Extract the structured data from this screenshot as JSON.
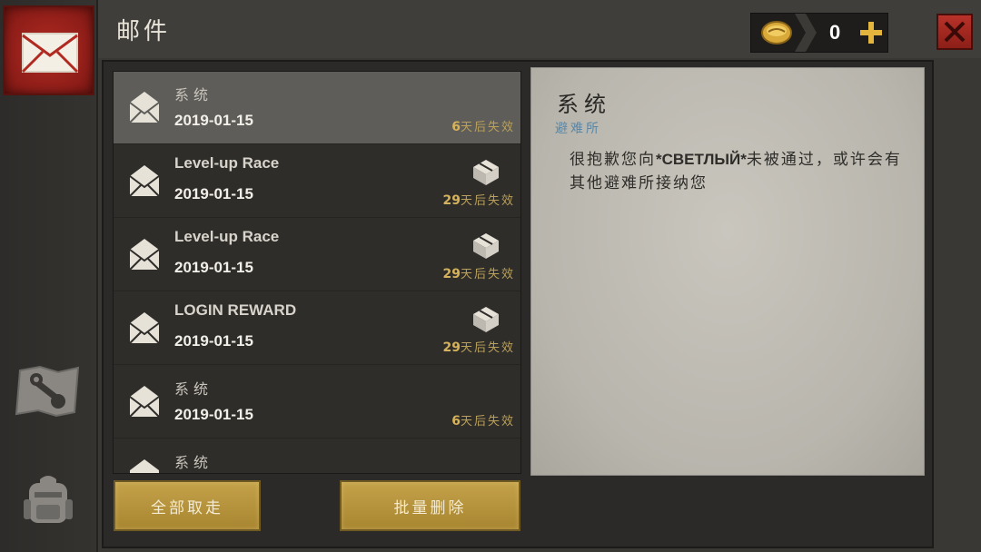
{
  "header": {
    "title": "邮件",
    "currency": {
      "value": "0",
      "icon": "gold-coin-icon"
    },
    "close_icon": "close-icon",
    "plus_icon": "plus-icon"
  },
  "sidebar": {
    "tabs": [
      {
        "name": "mail",
        "icon": "envelope-icon",
        "active": true
      },
      {
        "name": "map",
        "icon": "map-wrench-icon",
        "active": false
      },
      {
        "name": "backpack",
        "icon": "backpack-icon",
        "active": false
      }
    ]
  },
  "mail_list": {
    "items": [
      {
        "sender": "系统",
        "date": "2019-01-15",
        "expire_days": "6",
        "expire_text": "天后失效",
        "has_gift": false,
        "selected": true
      },
      {
        "sender": "Level-up Race",
        "date": "2019-01-15",
        "expire_days": "29",
        "expire_text": "天后失效",
        "has_gift": true,
        "selected": false
      },
      {
        "sender": "Level-up Race",
        "date": "2019-01-15",
        "expire_days": "29",
        "expire_text": "天后失效",
        "has_gift": true,
        "selected": false
      },
      {
        "sender": "LOGIN REWARD",
        "date": "2019-01-15",
        "expire_days": "29",
        "expire_text": "天后失效",
        "has_gift": true,
        "selected": false
      },
      {
        "sender": "系统",
        "date": "2019-01-15",
        "expire_days": "6",
        "expire_text": "天后失效",
        "has_gift": false,
        "selected": false
      },
      {
        "sender": "系统",
        "date": "",
        "expire_days": "",
        "expire_text": "",
        "has_gift": false,
        "selected": false
      }
    ]
  },
  "detail": {
    "title": "系统",
    "subtitle": "避难所",
    "body_prefix": "很抱歉您向",
    "body_highlight": "*СВЕТЛЫЙ*",
    "body_suffix": "未被通过，或许会有其他避难所接纳您"
  },
  "buttons": {
    "claim_all": "全部取走",
    "batch_delete": "批量删除"
  },
  "colors": {
    "accent_gold": "#c4a24a",
    "active_tab_red": "#b02a22",
    "expire_gold": "#d6b35a",
    "subtitle_blue": "#5a87a5"
  }
}
